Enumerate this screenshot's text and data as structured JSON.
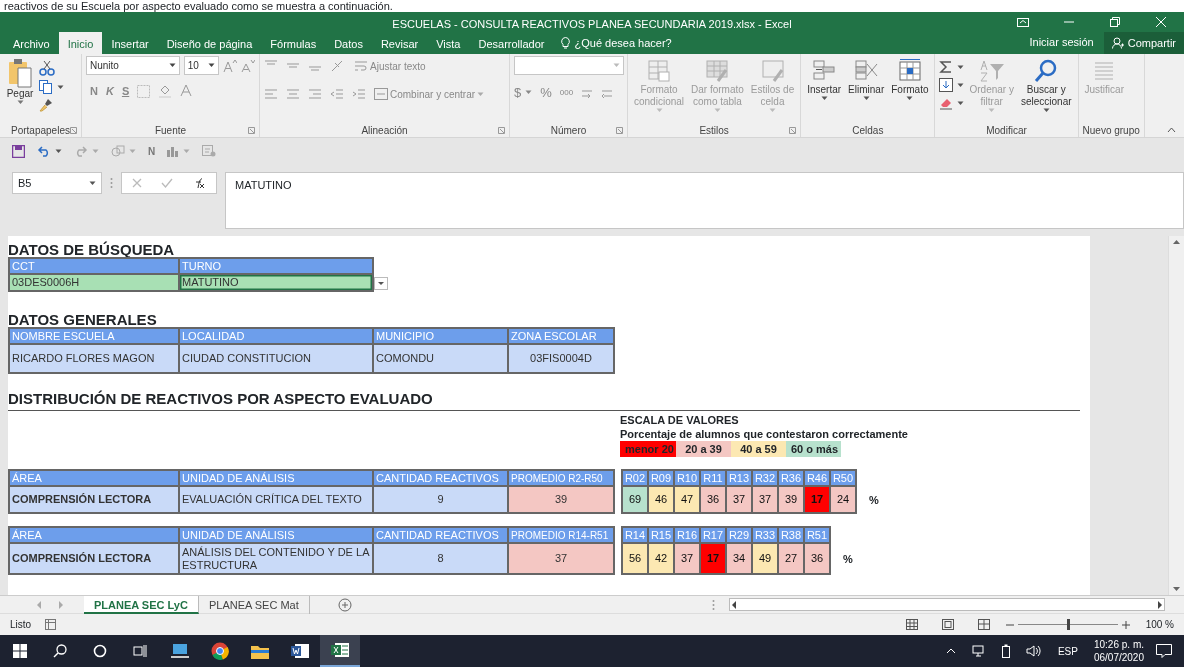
{
  "document_line": "reactivos de su Escuela por aspecto evaluado como se muestra a continuación.",
  "window": {
    "title": "ESCUELAS - CONSULTA REACTIVOS PLANEA SECUNDARIA 2019.xlsx - Excel"
  },
  "ribbon_tabs": [
    {
      "label": "Archivo",
      "selected": false
    },
    {
      "label": "Inicio",
      "selected": true
    },
    {
      "label": "Insertar",
      "selected": false
    },
    {
      "label": "Diseño de página",
      "selected": false
    },
    {
      "label": "Fórmulas",
      "selected": false
    },
    {
      "label": "Datos",
      "selected": false
    },
    {
      "label": "Revisar",
      "selected": false
    },
    {
      "label": "Vista",
      "selected": false
    },
    {
      "label": "Desarrollador",
      "selected": false
    }
  ],
  "tell_me": "¿Qué desea hacer?",
  "sign_in": "Iniciar sesión",
  "share": "Compartir",
  "ribbon_groups": [
    {
      "kind": "clipboard",
      "label": "Portapapeles",
      "paste": "Pegar"
    },
    {
      "kind": "font",
      "label": "Fuente",
      "font": "Nunito",
      "size": "10",
      "styles": [
        "N",
        "K",
        "S"
      ]
    },
    {
      "kind": "alignment",
      "label": "Alineación",
      "wrap": "Ajustar texto",
      "merge": "Combinar y centrar"
    },
    {
      "kind": "number",
      "label": "Número",
      "currency": "$",
      "percent": "%",
      "thousands": "000"
    },
    {
      "kind": "large",
      "label": "Estilos",
      "buttons": [
        {
          "lines": [
            "Formato",
            "condicional"
          ],
          "disabled": true
        },
        {
          "lines": [
            "Dar formato",
            "como tabla"
          ],
          "disabled": true
        },
        {
          "lines": [
            "Estilos de",
            "celda"
          ],
          "disabled": true
        }
      ]
    },
    {
      "kind": "large",
      "label": "Celdas",
      "buttons": [
        {
          "lines": [
            "Insertar"
          ],
          "disabled": false
        },
        {
          "lines": [
            "Eliminar"
          ],
          "disabled": false
        },
        {
          "lines": [
            "Formato"
          ],
          "disabled": false
        }
      ]
    },
    {
      "kind": "editing",
      "label": "Modificar",
      "buttons": [
        {
          "lines": [
            "Ordenar y",
            "filtrar"
          ],
          "disabled": true
        },
        {
          "lines": [
            "Buscar y",
            "seleccionar"
          ],
          "disabled": false
        }
      ]
    },
    {
      "kind": "large",
      "label": "Nuevo grupo",
      "buttons": [
        {
          "lines": [
            "Justificar"
          ],
          "disabled": true
        }
      ]
    }
  ],
  "quick_access": {
    "bold_letter": "N"
  },
  "formula_bar": {
    "name_box": "B5",
    "value": "MATUTINO"
  },
  "sheet": {
    "search": {
      "title": "DATOS DE BÚSQUEDA",
      "headers": [
        "CCT",
        "TURNO"
      ],
      "values": [
        "03DES0006H",
        "MATUTINO"
      ]
    },
    "general": {
      "title": "DATOS GENERALES",
      "headers": [
        "NOMBRE ESCUELA",
        "LOCALIDAD",
        "MUNICIPIO",
        "ZONA ESCOLAR"
      ],
      "values": [
        "RICARDO FLORES MAGON",
        "CIUDAD CONSTITUCION",
        "COMONDU",
        "03FIS0004D"
      ]
    },
    "distribution_title": "DISTRIBUCIÓN DE REACTIVOS POR ASPECTO EVALUADO",
    "scale": {
      "title": "ESCALA DE VALORES",
      "subtitle": "Porcentaje de alumnos que contestaron correctamente",
      "items": [
        {
          "label": "menor 20",
          "color": "#ff0000"
        },
        {
          "label": "20 a 39",
          "color": "#f4c7c3"
        },
        {
          "label": "40 a 59",
          "color": "#fce8b2"
        },
        {
          "label": "60 o más",
          "color": "#b7e1cd"
        }
      ]
    },
    "blocks": [
      {
        "headers": [
          "ÁREA",
          "UNIDAD DE ANÁLISIS",
          "CANTIDAD REACTIVOS",
          "PROMEDIO R2-R50"
        ],
        "area": "COMPRENSIÓN LECTORA",
        "unit": "EVALUACIÓN CRÍTICA DEL TEXTO",
        "count": "9",
        "average": {
          "value": "39",
          "color": "#f4c7c3"
        },
        "unit_sign": "%",
        "items": [
          {
            "label": "R02",
            "value": "69",
            "color": "#b7e1cd",
            "bold": false
          },
          {
            "label": "R09",
            "value": "46",
            "color": "#fce8b2",
            "bold": false
          },
          {
            "label": "R10",
            "value": "47",
            "color": "#fce8b2",
            "bold": false
          },
          {
            "label": "R11",
            "value": "36",
            "color": "#f4c7c3",
            "bold": false
          },
          {
            "label": "R13",
            "value": "37",
            "color": "#f4c7c3",
            "bold": false
          },
          {
            "label": "R32",
            "value": "37",
            "color": "#f4c7c3",
            "bold": false
          },
          {
            "label": "R36",
            "value": "39",
            "color": "#f4c7c3",
            "bold": false
          },
          {
            "label": "R46",
            "value": "17",
            "color": "#ff0000",
            "bold": true
          },
          {
            "label": "R50",
            "value": "24",
            "color": "#f4c7c3",
            "bold": false
          }
        ]
      },
      {
        "headers": [
          "ÁREA",
          "UNIDAD DE ANÁLISIS",
          "CANTIDAD REACTIVOS",
          "PROMEDIO R14-R51"
        ],
        "area": "COMPRENSIÓN LECTORA",
        "unit": "ANÁLISIS DEL CONTENIDO Y DE LA ESTRUCTURA",
        "count": "8",
        "average": {
          "value": "37",
          "color": "#f4c7c3"
        },
        "unit_sign": "%",
        "items": [
          {
            "label": "R14",
            "value": "56",
            "color": "#fce8b2",
            "bold": false
          },
          {
            "label": "R15",
            "value": "42",
            "color": "#fce8b2",
            "bold": false
          },
          {
            "label": "R16",
            "value": "37",
            "color": "#f4c7c3",
            "bold": false
          },
          {
            "label": "R17",
            "value": "17",
            "color": "#ff0000",
            "bold": true
          },
          {
            "label": "R29",
            "value": "34",
            "color": "#f4c7c3",
            "bold": false
          },
          {
            "label": "R33",
            "value": "49",
            "color": "#fce8b2",
            "bold": false
          },
          {
            "label": "R38",
            "value": "27",
            "color": "#f4c7c3",
            "bold": false
          },
          {
            "label": "R51",
            "value": "36",
            "color": "#f4c7c3",
            "bold": false
          }
        ]
      }
    ]
  },
  "sheet_tabs": [
    {
      "label": "PLANEA SEC LyC",
      "selected": true
    },
    {
      "label": "PLANEA SEC Mat",
      "selected": false
    }
  ],
  "status_bar": {
    "text": "Listo",
    "zoom": "100 %",
    "zoom_slider": {
      "level": 0.5
    }
  },
  "taskbar": {
    "language": "ESP",
    "time": "10:26 p. m.",
    "date": "06/07/2020"
  }
}
